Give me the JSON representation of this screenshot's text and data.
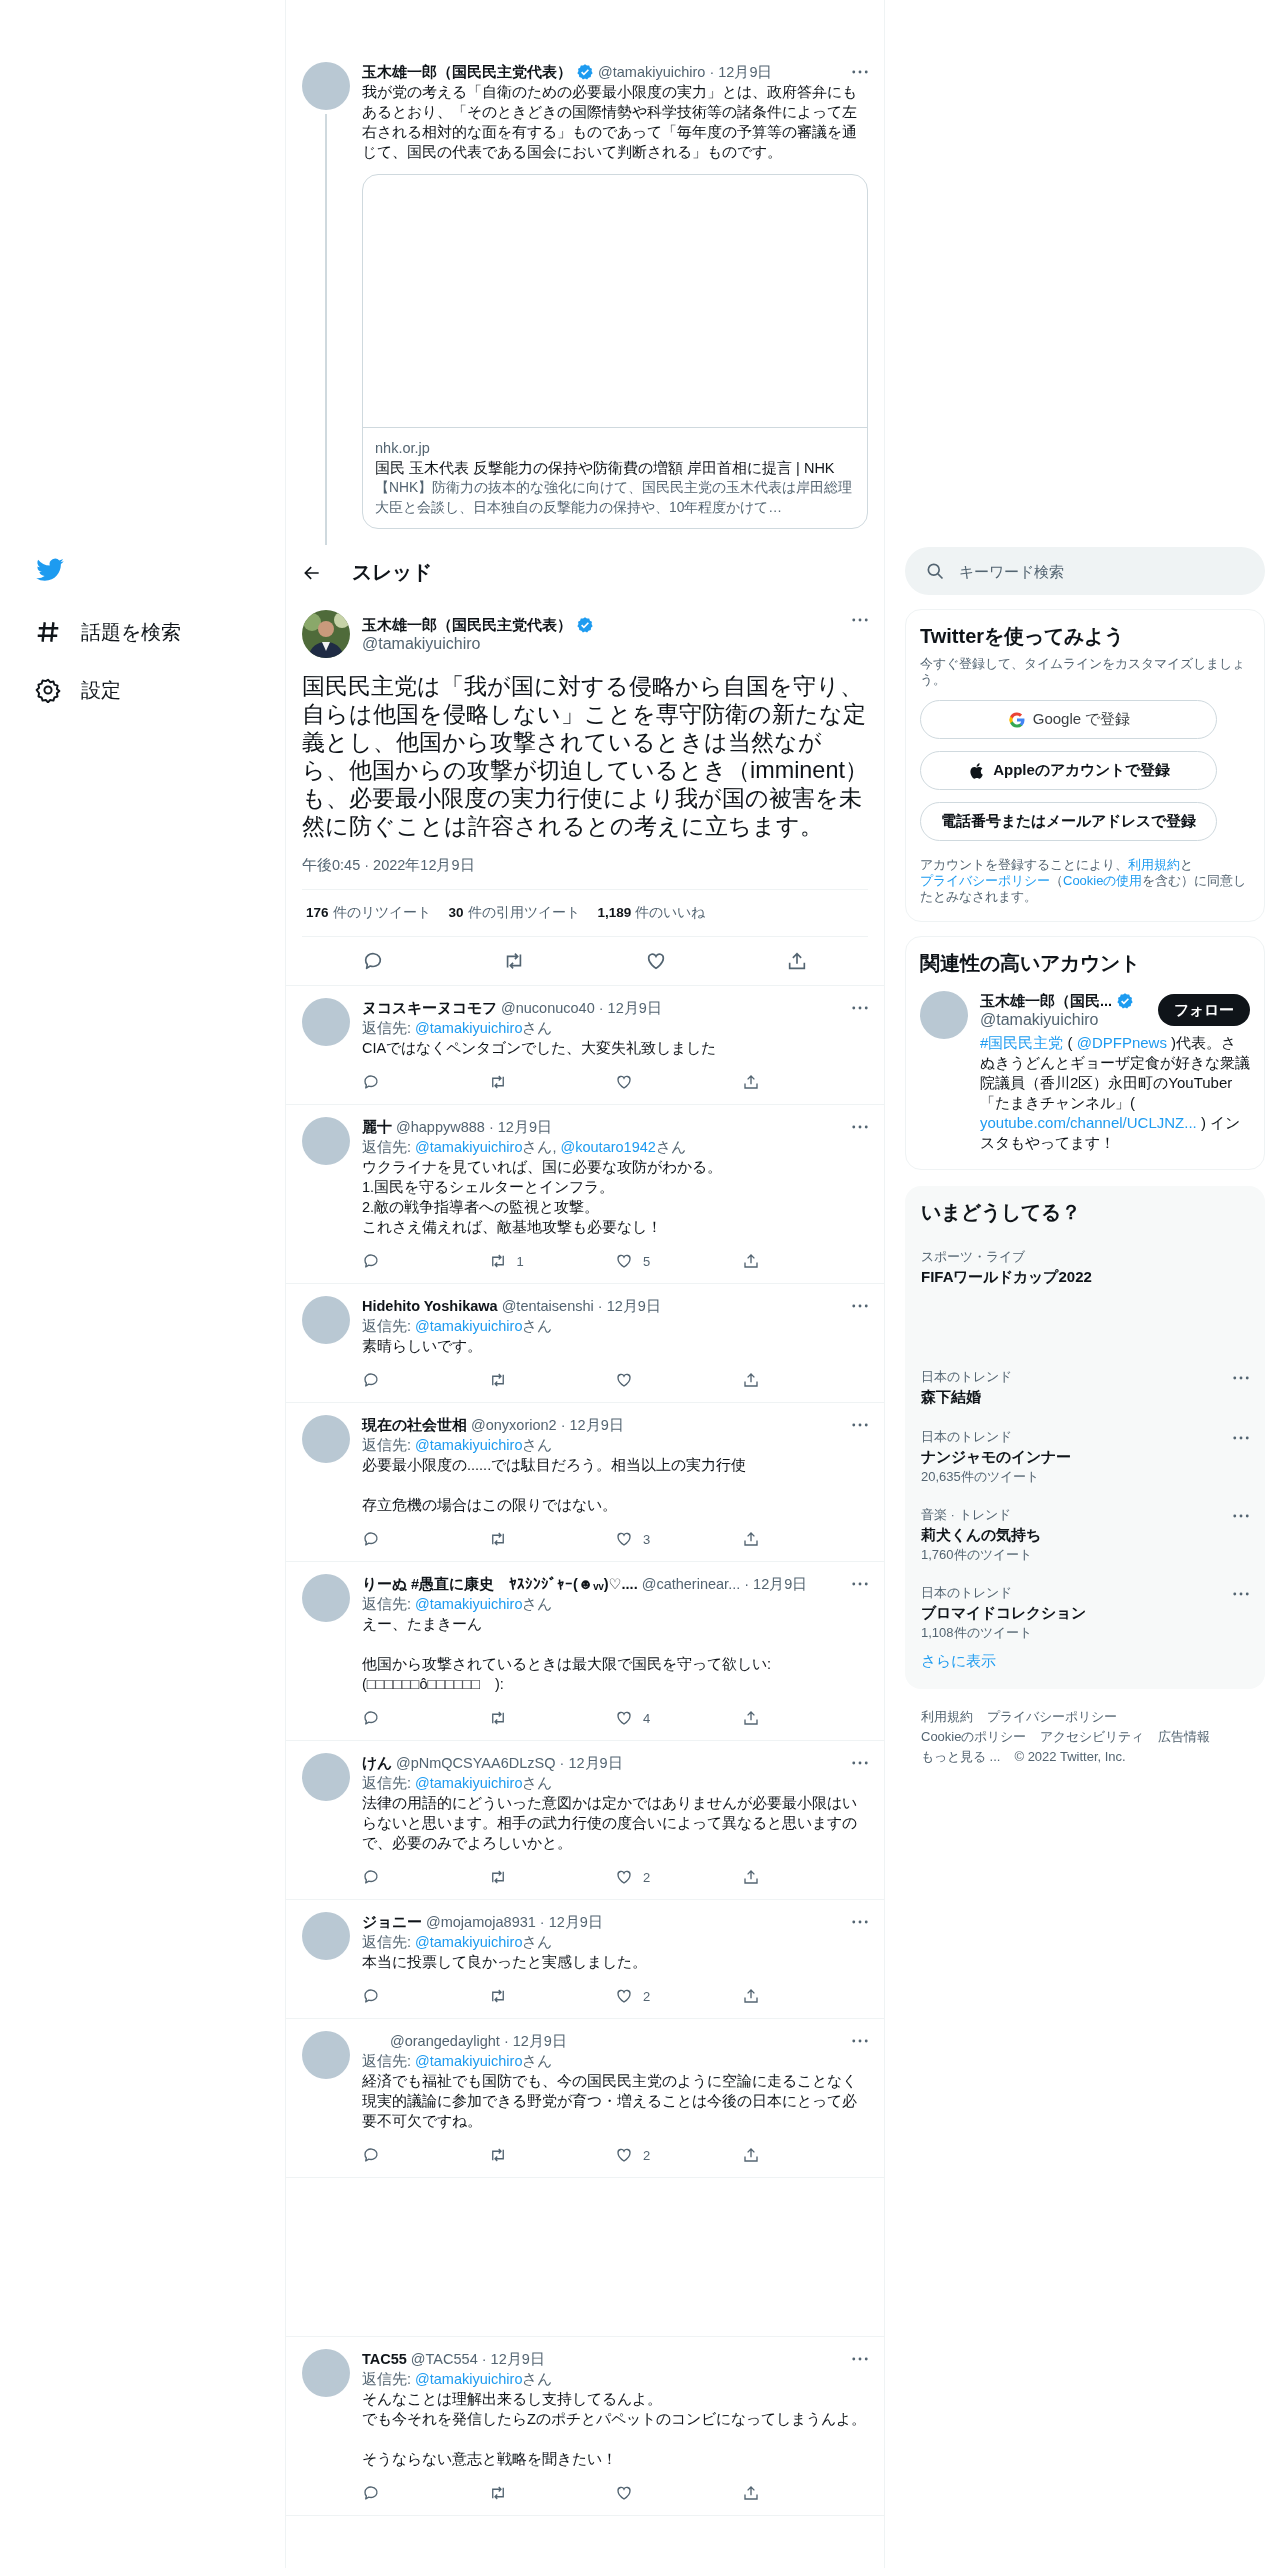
{
  "sidebar": {
    "items": [
      {
        "kind": "hash",
        "label": "話題を検索"
      },
      {
        "kind": "gear",
        "label": "設定"
      }
    ]
  },
  "previous_tweet": {
    "name": "玉木雄一郎（国民民主党代表）",
    "verified": true,
    "meta": "@tamakiyuichiro · 12月9日",
    "text": "我が党の考える「自衛のための必要最小限度の実力」とは、政府答弁にもあるとおり、「そのときどきの国際情勢や科学技術等の諸条件によって左右される相対的な面を有する」ものであって「毎年度の予算等の審議を通じて、国民の代表である国会において判断される」ものです。",
    "link_card": {
      "domain": "nhk.or.jp",
      "title": "国民 玉木代表 反撃能力の保持や防衛費の増額 岸田首相に提言 | NHK",
      "description": "【NHK】防衛力の抜本的な強化に向けて、国民民主党の玉木代表は岸田総理大臣と会談し、日本独自の反撃能力の保持や、10年程度かけて…"
    }
  },
  "header": {
    "title": "スレッド"
  },
  "main_tweet": {
    "name": "玉木雄一郎（国民民主党代表）",
    "verified": true,
    "handle": "@tamakiyuichiro",
    "text": "国民民主党は「我が国に対する侵略から自国を守り、自らは他国を侵略しない」ことを専守防衛の新たな定義とし、他国から攻撃されているときは当然ながら、他国からの攻撃が切迫しているとき（imminent）も、必要最小限度の実力行使により我が国の被害を未然に防ぐことは許容されるとの考えに立ちます。",
    "timestamp": "午後0:45 · 2022年12月9日",
    "stats": [
      {
        "count": "176",
        "label": "件のリツイート"
      },
      {
        "count": "30",
        "label": "件の引用ツイート"
      },
      {
        "count": "1,189",
        "label": "件のいいね"
      }
    ]
  },
  "replies": [
    {
      "name": "ヌコスキーヌコモフ",
      "meta": "@nuconuco40 · 12月9日",
      "reply_to": [
        {
          "kind": "text",
          "text": "返信先: "
        },
        {
          "kind": "link",
          "text": "@tamakiyuichiro"
        },
        {
          "kind": "text",
          "text": "さん"
        }
      ],
      "paragraphs": [
        [
          "CIAではなくペンタゴンでした、大変失礼致しました"
        ]
      ]
    },
    {
      "name": "麗十",
      "meta": "@happyw888 · 12月9日",
      "reply_to": [
        {
          "kind": "text",
          "text": "返信先: "
        },
        {
          "kind": "link",
          "text": "@tamakiyuichiro"
        },
        {
          "kind": "text",
          "text": "さん, "
        },
        {
          "kind": "link",
          "text": "@koutaro1942"
        },
        {
          "kind": "text",
          "text": "さん"
        }
      ],
      "paragraphs": [
        [
          "ウクライナを見ていれば、国に必要な攻防がわかる。",
          "1.国民を守るシェルターとインフラ。",
          "2.敵の戦争指導者への監視と攻撃。",
          "これさえ備えれば、敵基地攻撃も必要なし！"
        ]
      ],
      "retweets": "1",
      "likes": "5"
    },
    {
      "name": "Hidehito Yoshikawa",
      "meta": "@tentaisenshi · 12月9日",
      "reply_to": [
        {
          "kind": "text",
          "text": "返信先: "
        },
        {
          "kind": "link",
          "text": "@tamakiyuichiro"
        },
        {
          "kind": "text",
          "text": "さん"
        }
      ],
      "paragraphs": [
        [
          "素晴らしいです。"
        ]
      ]
    },
    {
      "name": "現在の社会世相",
      "meta": "@onyxorion2 · 12月9日",
      "reply_to": [
        {
          "kind": "text",
          "text": "返信先: "
        },
        {
          "kind": "link",
          "text": "@tamakiyuichiro"
        },
        {
          "kind": "text",
          "text": "さん"
        }
      ],
      "paragraphs": [
        [
          "必要最小限度の......では駄目だろう。相当以上の実力行使"
        ],
        [
          "存立危機の場合はこの限りではない。"
        ]
      ],
      "likes": "3"
    },
    {
      "name": "りーぬ #愚直に康史　ﾔｽｼﾝｼﾞｬｰ(☻ᵥᵥ)♡....",
      "meta": "@catherinear...  · 12月9日",
      "reply_to": [
        {
          "kind": "text",
          "text": "返信先: "
        },
        {
          "kind": "link",
          "text": "@tamakiyuichiro"
        },
        {
          "kind": "text",
          "text": "さん"
        }
      ],
      "paragraphs": [
        [
          "えー、たまきーん"
        ],
        [
          "他国から攻撃されているときは最大限で国民を守って欲しい:(□□□□□□ô□□□□□□　):"
        ]
      ],
      "likes": "4"
    },
    {
      "name": "けん",
      "meta": "@pNmQCSYAA6DLzSQ · 12月9日",
      "reply_to": [
        {
          "kind": "text",
          "text": "返信先: "
        },
        {
          "kind": "link",
          "text": "@tamakiyuichiro"
        },
        {
          "kind": "text",
          "text": "さん"
        }
      ],
      "paragraphs": [
        [
          "法律の用語的にどういった意図かは定かではありませんが必要最小限はいらないと思います。相手の武力行使の度合いによって異なると思いますので、必要のみでよろしいかと。"
        ]
      ],
      "likes": "2"
    },
    {
      "name": "ジョニー",
      "meta": "@mojamoja8931 · 12月9日",
      "reply_to": [
        {
          "kind": "text",
          "text": "返信先: "
        },
        {
          "kind": "link",
          "text": "@tamakiyuichiro"
        },
        {
          "kind": "text",
          "text": "さん"
        }
      ],
      "paragraphs": [
        [
          "本当に投票して良かったと実感しました。"
        ]
      ],
      "likes": "2"
    },
    {
      "meta": "@orangedaylight · 12月9日",
      "reply_to": [
        {
          "kind": "text",
          "text": "返信先: "
        },
        {
          "kind": "link",
          "text": "@tamakiyuichiro"
        },
        {
          "kind": "text",
          "text": "さん"
        }
      ],
      "paragraphs": [
        [
          "経済でも福祉でも国防でも、今の国民民主党のように空論に走ることなく現実的議論に参加できる野党が育つ・増えることは今後の日本にとって必要不可欠ですね。"
        ]
      ],
      "likes": "2"
    },
    {
      "name": "TAC55",
      "meta": "@TAC554 · 12月9日",
      "reply_to": [
        {
          "kind": "text",
          "text": "返信先: "
        },
        {
          "kind": "link",
          "text": "@tamakiyuichiro"
        },
        {
          "kind": "text",
          "text": "さん"
        }
      ],
      "paragraphs": [
        [
          "そんなことは理解出来るし支持してるんよ。",
          "でも今それを発信したらZのポチとパペットのコンビになってしまうんよ。"
        ],
        [
          "そうならない意志と戦略を聞きたい！"
        ]
      ]
    }
  ],
  "search": {
    "placeholder": "キーワード検索"
  },
  "signup": {
    "title": "Twitterを使ってみよう",
    "subtitle": "今すぐ登録して、タイムラインをカスタマイズしましょう。",
    "buttons": [
      {
        "kind": "google",
        "label": "Google で登録"
      },
      {
        "kind": "apple",
        "label": "Appleのアカウントで登録"
      },
      {
        "kind": "phone",
        "label": "電話番号またはメールアドレスで登録"
      }
    ],
    "disclaimer": [
      {
        "kind": "text",
        "text": "アカウントを登録することにより、"
      },
      {
        "kind": "link",
        "text": "利用規約"
      },
      {
        "kind": "text",
        "text": "と"
      },
      {
        "kind": "link",
        "text": "プライバシーポリシー"
      },
      {
        "kind": "text",
        "text": "（"
      },
      {
        "kind": "link",
        "text": "Cookieの使用"
      },
      {
        "kind": "text",
        "text": "を含む）に同意したとみなされます。"
      }
    ]
  },
  "related": {
    "title": "関連性の高いアカウント",
    "account": {
      "name": "玉木雄一郎（国民...",
      "verified": true,
      "handle": "@tamakiyuichiro",
      "follow": "フォロー",
      "bio": [
        {
          "kind": "link",
          "text": "#国民民主党"
        },
        {
          "kind": "text",
          "text": " ( "
        },
        {
          "kind": "link",
          "text": "@DPFPnews"
        },
        {
          "kind": "text",
          "text": " )代表。さぬきうどんとギョーザ定食が好きな衆議院議員（香川2区）永田町のYouTuber「たまきチャンネル」( "
        },
        {
          "kind": "link",
          "text": "youtube.com/channel/UCLJNZ..."
        },
        {
          "kind": "text",
          "text": " ) インスタもやってます！"
        }
      ]
    }
  },
  "trends": {
    "title": "いまどうしてる？",
    "items": [
      {
        "kind": "live",
        "category": "スポーツ・ライブ",
        "title": "FIFAワールドカップ2022"
      },
      {
        "kind": "trend",
        "category": "日本のトレンド",
        "title": "森下結婚"
      },
      {
        "kind": "trend",
        "category": "日本のトレンド",
        "title": "ナンジャモのインナー",
        "count": "20,635件のツイート"
      },
      {
        "kind": "trend",
        "category": "音楽 · トレンド",
        "title": "莉犬くんの気持ち",
        "count": "1,760件のツイート"
      },
      {
        "kind": "trend",
        "category": "日本のトレンド",
        "title": "ブロマイドコレクション",
        "count": "1,108件のツイート"
      }
    ],
    "show_more": "さらに表示"
  },
  "footer": {
    "lines": [
      [
        "利用規約",
        "プライバシーポリシー"
      ],
      [
        "Cookieのポリシー",
        "アクセシビリティ",
        "広告情報"
      ],
      [
        "もっと見る ...",
        "© 2022 Twitter, Inc."
      ]
    ]
  }
}
